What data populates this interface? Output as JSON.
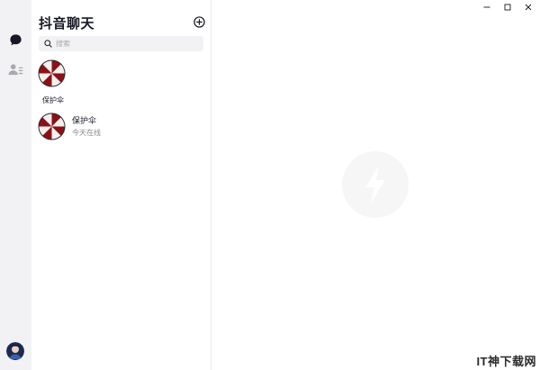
{
  "sidebar": {
    "items": [
      {
        "name": "chat",
        "icon": "chat-bubble-icon",
        "active": true
      },
      {
        "name": "contacts",
        "icon": "contacts-list-icon",
        "active": false
      }
    ],
    "user_avatar": "user-avatar"
  },
  "chat_list": {
    "title": "抖音聊天",
    "add_icon": "plus-circle-icon",
    "search": {
      "placeholder": "搜索",
      "value": ""
    },
    "pinned": {
      "name": "保护伞",
      "avatar": "umbrella-avatar"
    },
    "conversations": [
      {
        "name": "保护伞",
        "status": "今天在线",
        "avatar": "umbrella-avatar"
      }
    ]
  },
  "window_controls": {
    "minimize_label": "–",
    "maximize_label": "□",
    "close_label": "✕"
  },
  "main": {
    "placeholder_icon": "douyin-logo-watermark-icon"
  },
  "watermark": "IT神下载网",
  "colors": {
    "rail_bg": "#f2f2f4",
    "text_primary": "#161823",
    "text_secondary": "#8a8b91",
    "avatar_red": "#8b1118"
  }
}
